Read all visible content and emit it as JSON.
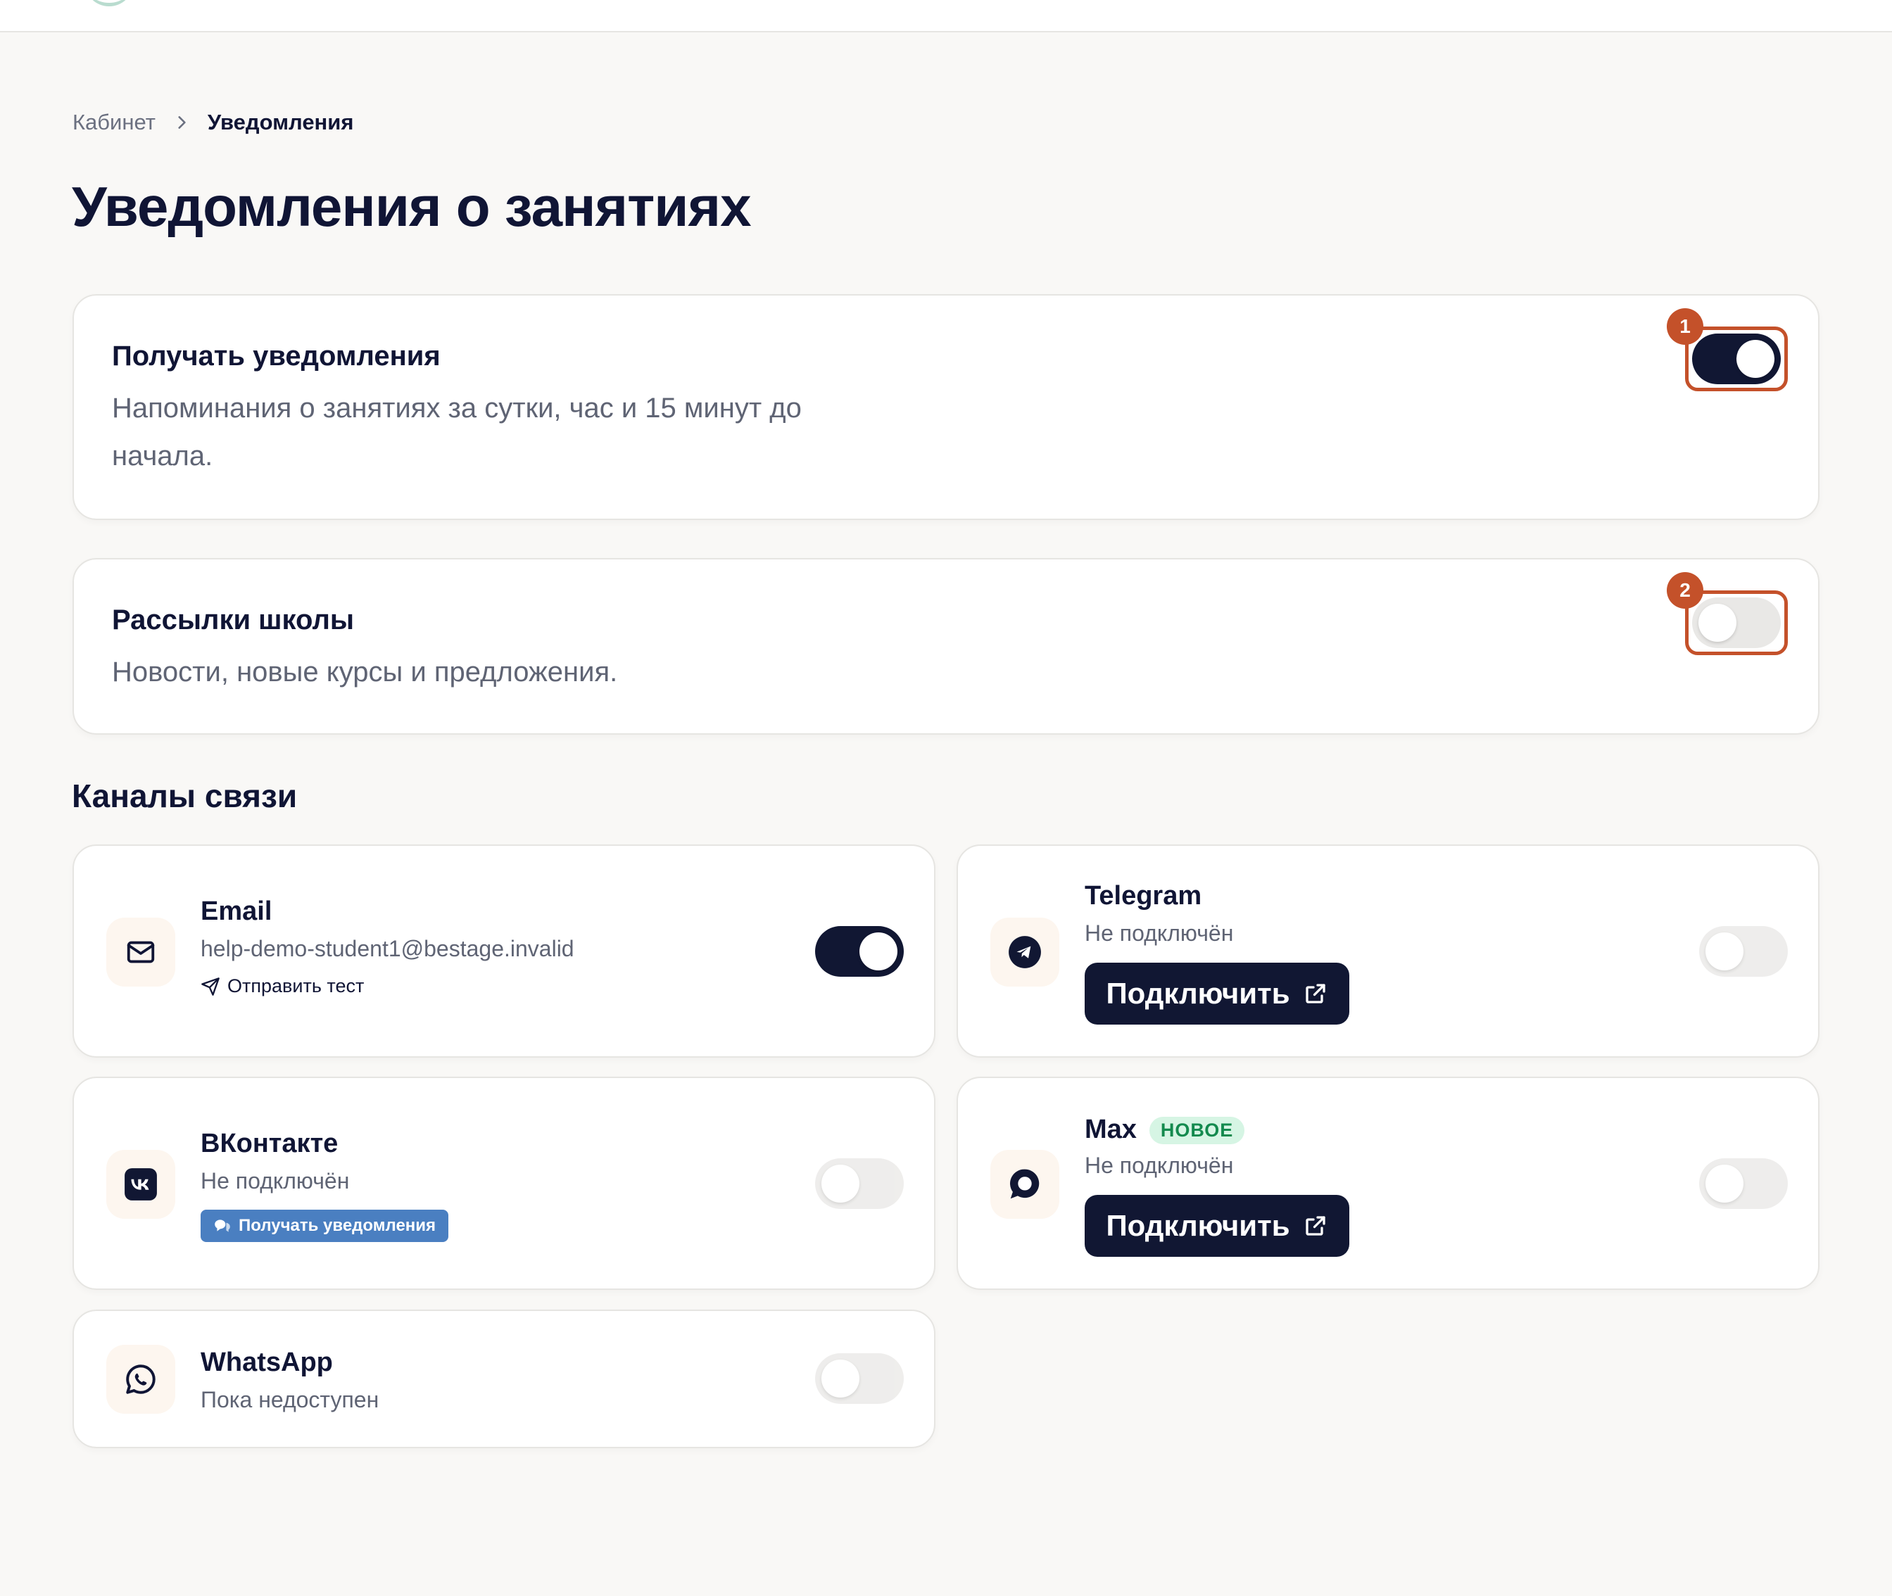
{
  "breadcrumb": {
    "parent": "Кабинет",
    "current": "Уведомления"
  },
  "page": {
    "title": "Уведомления о занятиях"
  },
  "preferences": [
    {
      "title": "Получать уведомления",
      "description": "Напоминания о занятиях за сутки, час и 15 минут до начала.",
      "enabled": true,
      "marker": "1"
    },
    {
      "title": "Рассылки школы",
      "description": "Новости, новые курсы и предложения.",
      "enabled": false,
      "marker": "2"
    }
  ],
  "channels_heading": "Каналы связи",
  "channels": {
    "email": {
      "name": "Email",
      "address": "help-demo-student1@bestage.invalid",
      "test_label": "Отправить тест",
      "enabled": true,
      "icon": "mail-icon"
    },
    "telegram": {
      "name": "Telegram",
      "status": "Не подключён",
      "button": "Подключить",
      "enabled": false,
      "icon": "telegram-icon"
    },
    "vk": {
      "name": "ВКонтакте",
      "status": "Не подключён",
      "button": "Получать уведомления",
      "enabled": false,
      "icon": "vk-icon"
    },
    "max": {
      "name": "Max",
      "badge": "НОВОЕ",
      "status": "Не подключён",
      "button": "Подключить",
      "enabled": false,
      "icon": "max-chat-icon"
    },
    "whatsapp": {
      "name": "WhatsApp",
      "status": "Пока недоступен",
      "enabled": false,
      "icon": "whatsapp-icon"
    }
  },
  "colors": {
    "primary": "#111733",
    "accent": "#c4512a",
    "badge_green": "#138a4e",
    "vk_blue": "#4a7fc1"
  }
}
